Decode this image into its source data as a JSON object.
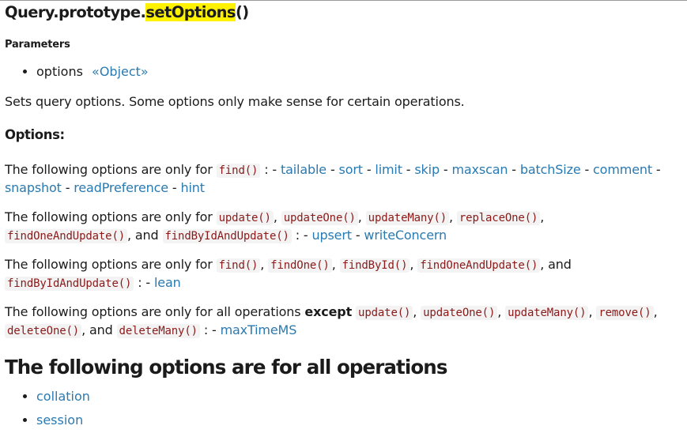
{
  "title": {
    "prefix": "Query.prototype.",
    "highlight": "setOptions",
    "suffix": "()"
  },
  "parameters_heading": "Parameters",
  "parameter": {
    "name": "options",
    "type": "«Object»"
  },
  "description": "Sets query options. Some options only make sense for certain operations.",
  "options_heading": "Options:",
  "find_only": {
    "lead": "The following options are only for",
    "ops": [
      "find()"
    ],
    "options": [
      "tailable",
      "sort",
      "limit",
      "skip",
      "maxscan",
      "batchSize",
      "comment",
      "snapshot",
      "readPreference",
      "hint"
    ]
  },
  "update_only": {
    "lead": "The following options are only for",
    "ops": [
      "update()",
      "updateOne()",
      "updateMany()",
      "replaceOne()",
      "findOneAndUpdate()",
      "findByIdAndUpdate()"
    ],
    "and": "and",
    "options": [
      "upsert",
      "writeConcern"
    ]
  },
  "lean_only": {
    "lead": "The following options are only for",
    "ops": [
      "find()",
      "findOne()",
      "findById()",
      "findOneAndUpdate()",
      "findByIdAndUpdate()"
    ],
    "and": "and",
    "options": [
      "lean"
    ]
  },
  "all_except": {
    "lead": "The following options are only for all operations",
    "except": "except",
    "ops": [
      "update()",
      "updateOne()",
      "updateMany()",
      "remove()",
      "deleteOne()",
      "deleteMany()"
    ],
    "and": "and",
    "options": [
      "maxTimeMS"
    ]
  },
  "all_ops_heading": "The following options are for all operations",
  "all_ops": [
    "collation",
    "session"
  ]
}
